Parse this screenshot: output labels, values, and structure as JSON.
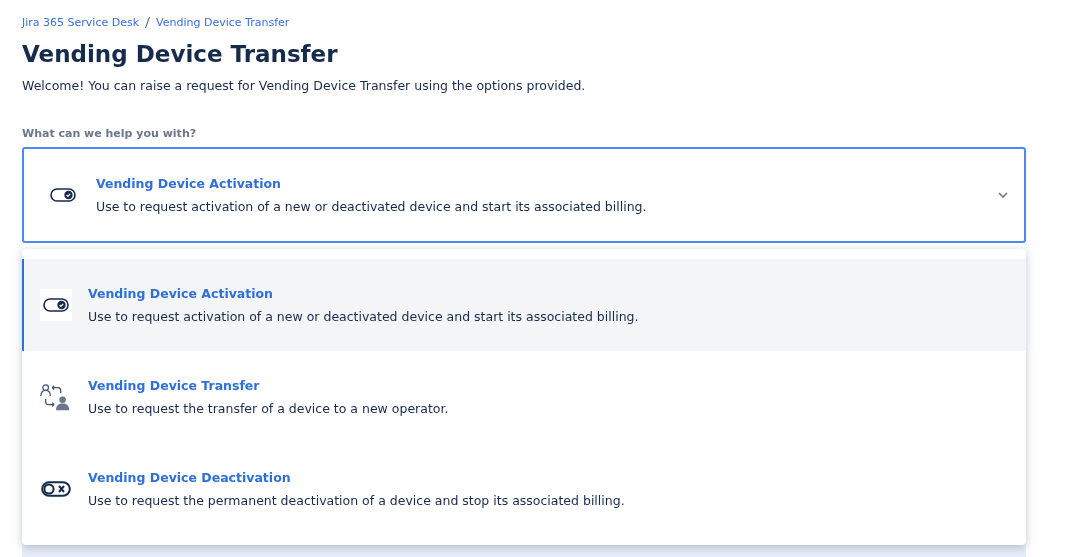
{
  "breadcrumbs": [
    "Jira 365 Service Desk",
    "Vending Device Transfer"
  ],
  "title": "Vending Device Transfer",
  "welcome": "Welcome! You can raise a request for Vending Device Transfer using the options provided.",
  "request_type": {
    "label": "What can we help you with?",
    "value": {
      "kind": "toggle-on",
      "title": "Vending Device Activation",
      "description": "Use to request activation of a new or deactivated device and start its associated billing."
    },
    "options": [
      {
        "kind": "toggle-on",
        "title": "Vending Device Activation",
        "description": "Use to request activation of a new or deactivated device and start its associated billing.",
        "selected": true
      },
      {
        "kind": "transfer",
        "title": "Vending Device Transfer",
        "description": "Use to request the transfer of a device to a new operator.",
        "selected": false
      },
      {
        "kind": "toggle-off",
        "title": "Vending Device Deactivation",
        "description": "Use to request the permanent deactivation of a device and stop its associated billing.",
        "selected": false
      }
    ]
  }
}
